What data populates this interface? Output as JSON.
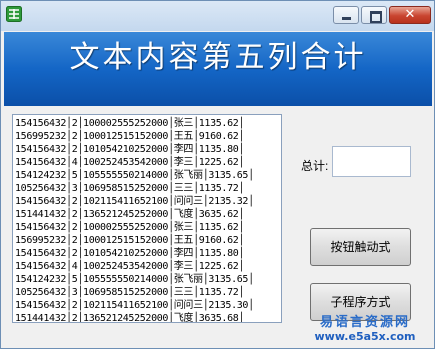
{
  "window": {
    "title": "",
    "colors": {
      "banner": "#1466c6",
      "titlebar": "#c4d8ee",
      "close": "#c94530"
    }
  },
  "controls": {
    "minimize_icon": "minimize-icon",
    "maximize_icon": "maximize-icon",
    "close_label": "✕"
  },
  "banner": {
    "title": "文本内容第五列合计"
  },
  "text_box": {
    "lines": [
      "154156432│2│100002555252000│张三│1135.62│",
      "156995232│2│100012515152000│王五│9160.62│",
      "154156432│2│101054210252000│李四│1135.80│",
      "154156432│4│100252453542000│李三│1225.62│",
      "154124232│5│105555550214000│张飞丽│3135.65│",
      "105256432│3│106958515252000│三三│1135.72│",
      "154156432│2│102115411652100│问问三│2135.32│",
      "151441432│2│136521245252000│飞度│3635.62│",
      "154156432│2│100002555252000│张三│1135.62│",
      "156995232│2│100012515152000│王五│9160.62│",
      "154156432│2│101054210252000│李四│1135.80│",
      "154156432│4│100252453542000│李三│1225.62│",
      "154124232│5│105555550214000│张飞丽│3135.65│",
      "105256432│3│106958515252000│三三│1135.72│",
      "154156432│2│102115411652100│问问三│2135.30│",
      "151441432│2│136521245252000│飞度│3635.68│"
    ]
  },
  "total": {
    "label": "总计:",
    "value": ""
  },
  "buttons": {
    "button_trigger": "按钮触动式",
    "subroutine": "子程序方式"
  },
  "watermark": {
    "cn": "易语言资源网",
    "url": "www.e5a5x.com"
  }
}
